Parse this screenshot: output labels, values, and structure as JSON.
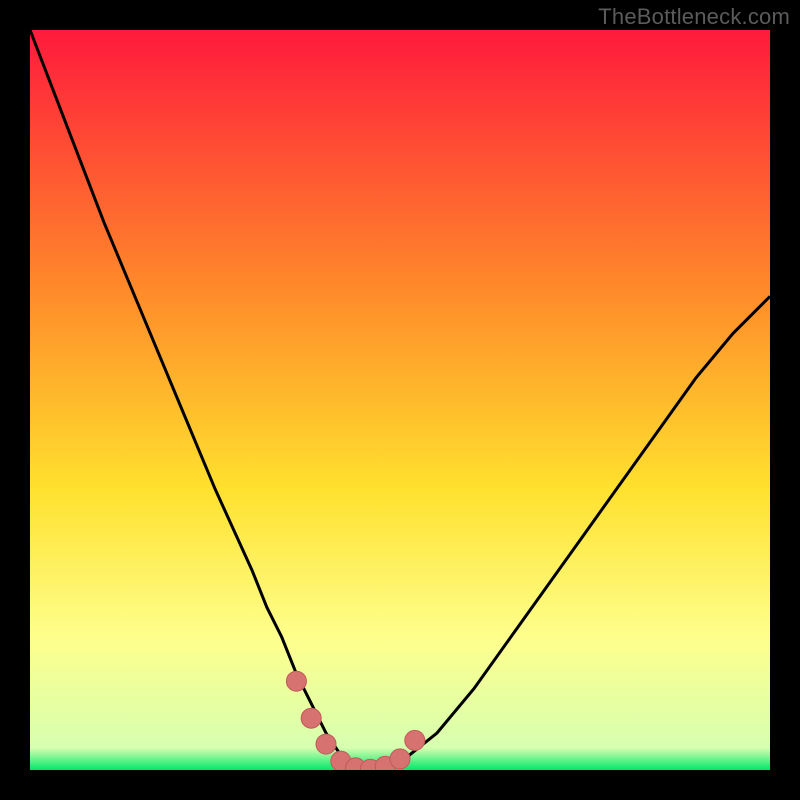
{
  "watermark": "TheBottleneck.com",
  "colors": {
    "background": "#000000",
    "gradient_top": "#ff1a3c",
    "gradient_mid1": "#ff8a2a",
    "gradient_mid2": "#ffe12e",
    "gradient_mid3": "#feff8c",
    "gradient_bottom": "#00e86b",
    "curve": "#000000",
    "marker_fill": "#d6726f",
    "marker_stroke": "#c05a5a"
  },
  "chart_data": {
    "type": "line",
    "title": "",
    "xlabel": "",
    "ylabel": "",
    "xlim": [
      0,
      100
    ],
    "ylim": [
      0,
      100
    ],
    "series": [
      {
        "name": "bottleneck-curve",
        "x": [
          0,
          5,
          10,
          15,
          20,
          25,
          30,
          32,
          34,
          36,
          38,
          40,
          42,
          44,
          46,
          48,
          50,
          55,
          60,
          65,
          70,
          75,
          80,
          85,
          90,
          95,
          100
        ],
        "y": [
          100,
          87,
          74,
          62,
          50,
          38,
          27,
          22,
          18,
          13,
          9,
          5,
          2,
          0.5,
          0,
          0,
          1,
          5,
          11,
          18,
          25,
          32,
          39,
          46,
          53,
          59,
          64
        ]
      }
    ],
    "markers": {
      "name": "optimal-range",
      "x": [
        36,
        38,
        40,
        42,
        44,
        46,
        48,
        50,
        52
      ],
      "y": [
        12,
        7,
        3.5,
        1.2,
        0.3,
        0.1,
        0.5,
        1.5,
        4
      ]
    },
    "gradient_stops": [
      {
        "offset": 0,
        "color": "#ff1a3c"
      },
      {
        "offset": 35,
        "color": "#ff8a2a"
      },
      {
        "offset": 62,
        "color": "#ffe12e"
      },
      {
        "offset": 82,
        "color": "#feff8c"
      },
      {
        "offset": 97,
        "color": "#d7ffb0"
      },
      {
        "offset": 100,
        "color": "#00e86b"
      }
    ]
  }
}
